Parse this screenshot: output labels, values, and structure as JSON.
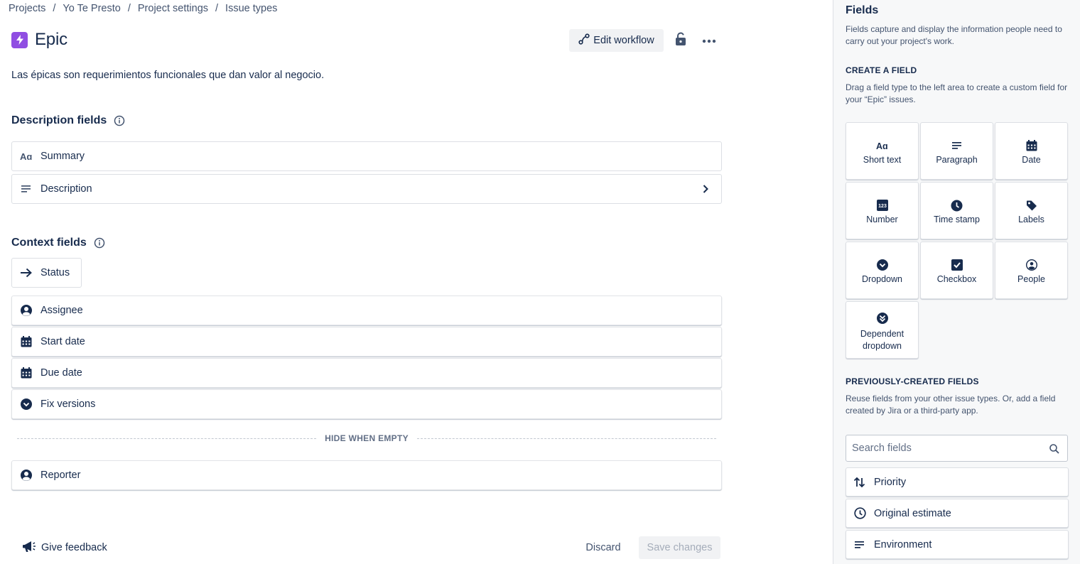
{
  "breadcrumb": [
    "Projects",
    "Yo Te Presto",
    "Project settings",
    "Issue types"
  ],
  "breadcrumb_separator": "/",
  "issue_type": {
    "title": "Epic",
    "icon": "epic-lightning-icon",
    "color": "#904ee2",
    "description": "Las épicas son requerimientos funcionales que dan valor al negocio."
  },
  "toolbar": {
    "edit_workflow_label": "Edit workflow"
  },
  "description_fields": {
    "title": "Description fields",
    "items": [
      {
        "label": "Summary",
        "icon": "text-icon"
      },
      {
        "label": "Description",
        "icon": "paragraph-icon"
      }
    ]
  },
  "context_fields": {
    "title": "Context fields",
    "status_label": "Status",
    "items": [
      {
        "label": "Assignee",
        "icon": "person-icon"
      },
      {
        "label": "Start date",
        "icon": "calendar-icon"
      },
      {
        "label": "Due date",
        "icon": "calendar-icon"
      },
      {
        "label": "Fix versions",
        "icon": "dropdown-icon"
      }
    ],
    "hide_when_empty_label": "HIDE WHEN EMPTY",
    "hidden_items": [
      {
        "label": "Reporter",
        "icon": "person-icon"
      }
    ]
  },
  "footer": {
    "feedback_label": "Give feedback",
    "discard_label": "Discard",
    "save_label": "Save changes"
  },
  "panel": {
    "title": "Fields",
    "subtitle": "Fields capture and display the information people need to carry out your project's work.",
    "create_heading": "CREATE A FIELD",
    "create_sub": "Drag a field type to the left area to create a custom field for your “Epic” issues.",
    "field_types": [
      {
        "label": "Short text",
        "icon": "text-icon"
      },
      {
        "label": "Paragraph",
        "icon": "paragraph-icon"
      },
      {
        "label": "Date",
        "icon": "calendar-icon"
      },
      {
        "label": "Number",
        "icon": "number-icon"
      },
      {
        "label": "Time stamp",
        "icon": "clock-icon"
      },
      {
        "label": "Labels",
        "icon": "tag-icon"
      },
      {
        "label": "Dropdown",
        "icon": "dropdown-icon"
      },
      {
        "label": "Checkbox",
        "icon": "checkbox-icon"
      },
      {
        "label": "People",
        "icon": "person-icon"
      },
      {
        "label": "Dependent dropdown",
        "icon": "dependent-dropdown-icon"
      }
    ],
    "number_icon_text": "123",
    "prev_heading": "PREVIOUSLY-CREATED FIELDS",
    "prev_sub": "Reuse fields from your other issue types. Or, add a field created by Jira or a third-party app.",
    "search_placeholder": "Search fields",
    "prev_fields": [
      {
        "label": "Priority",
        "icon": "priority-icon"
      },
      {
        "label": "Original estimate",
        "icon": "clock-outline-icon"
      },
      {
        "label": "Environment",
        "icon": "paragraph-icon"
      }
    ]
  },
  "colors": {
    "text": "#172b4d",
    "subtle": "#44546f",
    "border": "#dcdfe4",
    "panel_bg": "#f7f8f9"
  }
}
